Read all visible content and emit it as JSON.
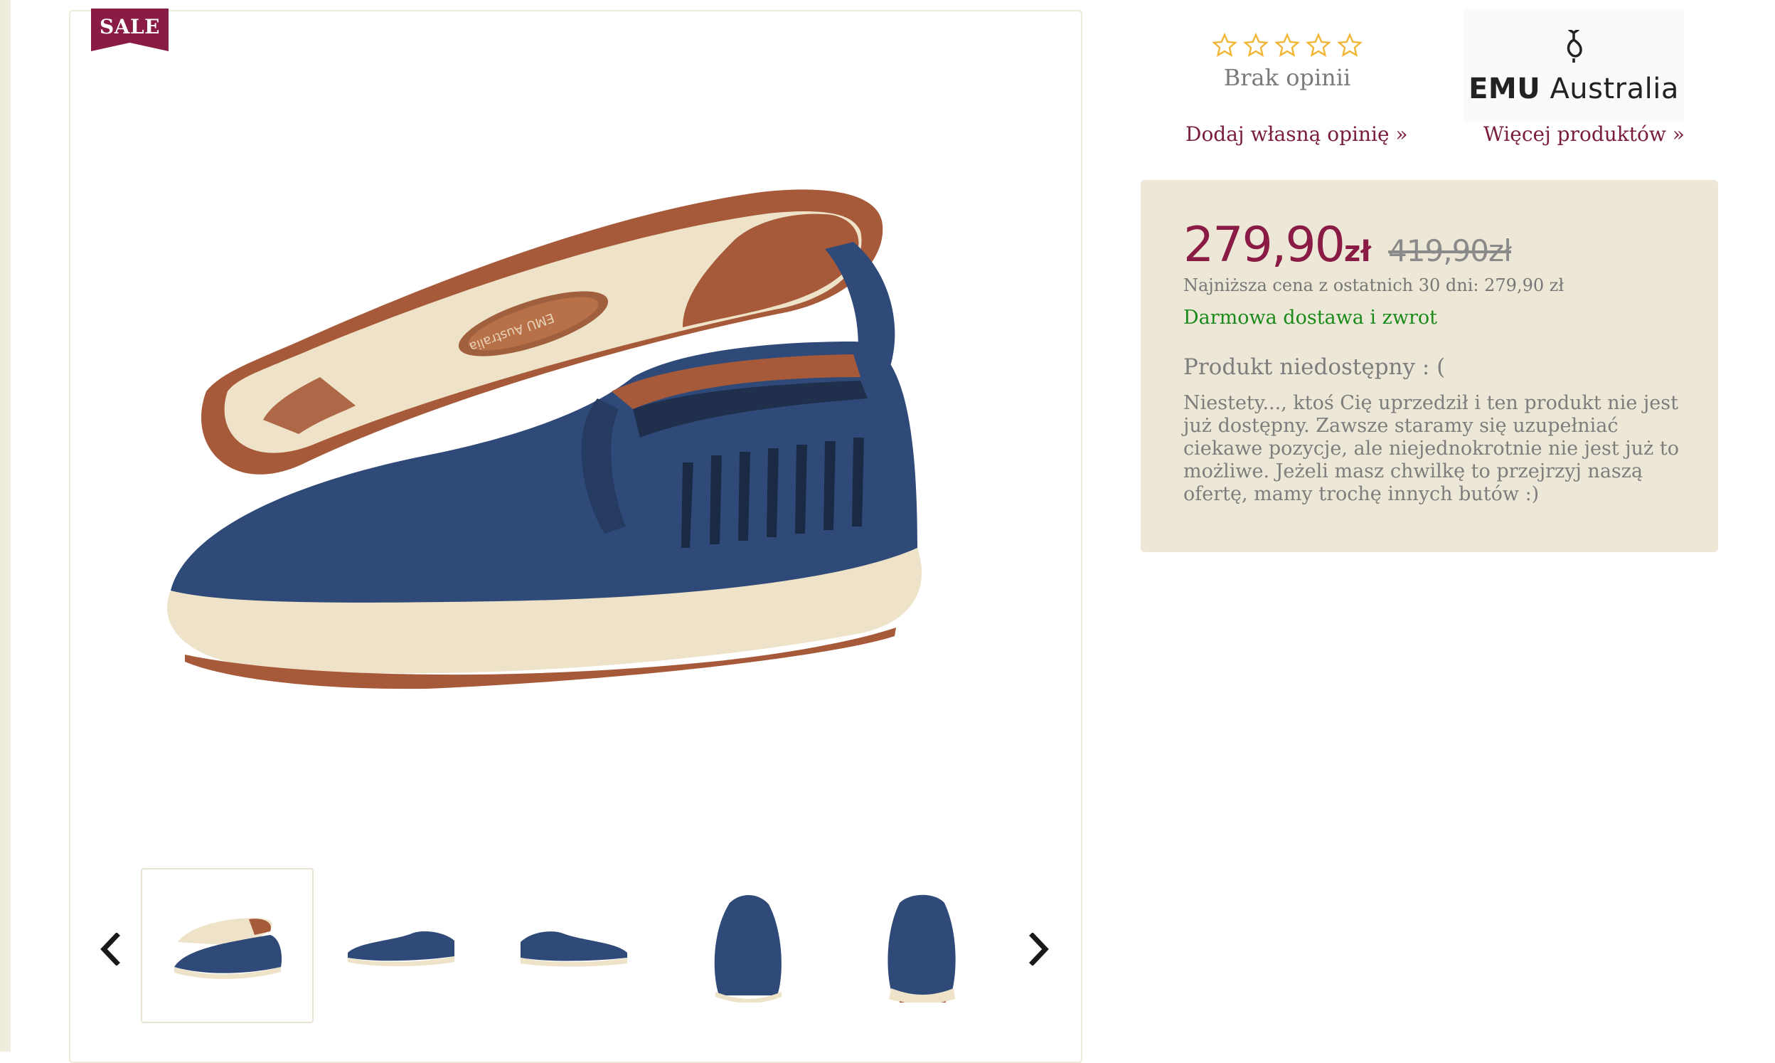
{
  "badge": {
    "label": "SALE",
    "color": "#8a1b44"
  },
  "product": {
    "brand_name": "EMU",
    "brand_suffix": "Australia",
    "sole_brand_imprint": "EMU Australia"
  },
  "gallery": {
    "prev_icon": "chevron-left-icon",
    "next_icon": "chevron-right-icon",
    "thumbnails": [
      "three-quarter view",
      "side view",
      "side view (inner)",
      "front view",
      "back view"
    ]
  },
  "rating": {
    "stars_total": 5,
    "stars_filled": 0,
    "text": "Brak opinii",
    "add_review_link": "Dodaj własną opinię »"
  },
  "brand": {
    "more_products_link": "Więcej produktów »"
  },
  "price": {
    "current": "279,90",
    "currency": "zł",
    "old": "419,90zł",
    "lowest_30_days": "Najniższa cena z ostatnich 30 dni: 279,90 zł",
    "shipping": "Darmowa dostawa i zwrot"
  },
  "availability": {
    "title": "Produkt niedostępny : (",
    "message": "Niestety..., ktoś Cię uprzedził i ten produkt nie jest już dostępny. Zawsze staramy się uzupełniać ciekawe pozycje, ale niejednokrotnie nie jest już to możliwe. Jeżeli masz chwilkę to przejrzyj naszą ofertę, mamy trochę innych butów :)"
  },
  "colors": {
    "accent": "#8a1b44",
    "link": "#7a1c3f",
    "price_box_bg": "#ece7d6",
    "shipping_green": "#1a8a1a",
    "star_gold": "#f2b534",
    "shoe_navy": "#2f4a78",
    "sole_cream": "#eee3c8",
    "sole_brown": "#a65a3a"
  }
}
